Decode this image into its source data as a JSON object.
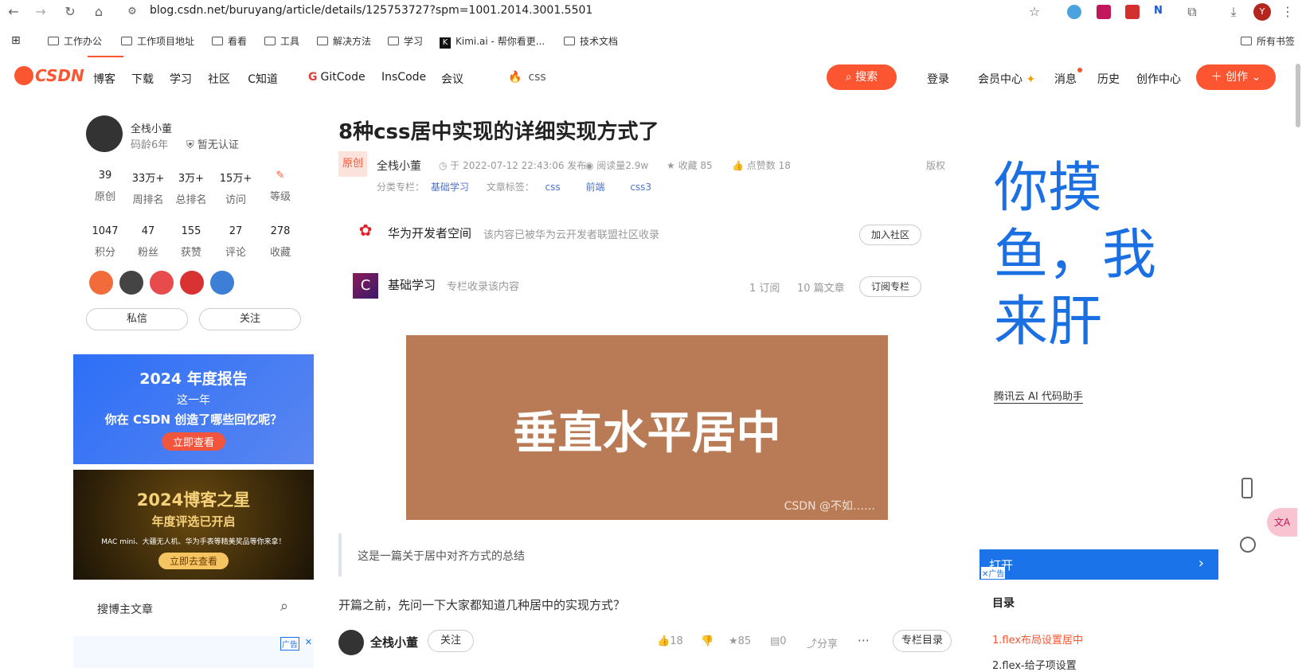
{
  "browser": {
    "url": "blog.csdn.net/buruyang/article/details/125753727?spm=1001.2014.3001.5501",
    "profile_initial": "Y",
    "bookmarks": [
      "工作办公",
      "工作项目地址",
      "看看",
      "工具",
      "解决方法",
      "学习",
      "Kimi.ai - 帮你看更...",
      "技术文档"
    ],
    "all_bookmarks": "所有书签"
  },
  "toolbar": {
    "logo": "CSDN",
    "nav": [
      "博客",
      "下载",
      "学习",
      "社区",
      "C知道",
      "GitCode",
      "InsCode",
      "会议"
    ],
    "search_placeholder": "css",
    "search_label": "搜索",
    "right": [
      "登录",
      "会员中心",
      "消息",
      "历史",
      "创作中心"
    ],
    "create_label": "创作"
  },
  "author": {
    "name": "全栈小董",
    "age": "码龄6年",
    "cert": "暂无认证",
    "stats_row1": [
      {
        "n": "39",
        "l": "原创"
      },
      {
        "n": "33万+",
        "l": "周排名"
      },
      {
        "n": "3万+",
        "l": "总排名"
      },
      {
        "n": "15万+",
        "l": "访问"
      },
      {
        "n": "",
        "l": "等级"
      }
    ],
    "stats_row2": [
      {
        "n": "1047",
        "l": "积分"
      },
      {
        "n": "47",
        "l": "粉丝"
      },
      {
        "n": "155",
        "l": "获赞"
      },
      {
        "n": "27",
        "l": "评论"
      },
      {
        "n": "278",
        "l": "收藏"
      }
    ],
    "message_label": "私信",
    "follow_label": "关注"
  },
  "ads": {
    "report_title": "2024 年度报告",
    "report_line1": "这一年",
    "report_line2": "你在 CSDN 创造了哪些回忆呢？",
    "report_btn": "立即查看",
    "star_title": "2024博客之星",
    "star_sub": "年度评选已开启",
    "star_desc": "MAC mini、大疆无人机、华为手表等精美奖品等你来拿！",
    "star_btn": "立即去查看",
    "ad_tag": "广告"
  },
  "search_blog": "搜博主文章",
  "article": {
    "title": "8种css居中实现的详细实现方式了",
    "original": "原创",
    "author": "全栈小董",
    "published": "于 2022-07-12 22:43:06 发布",
    "reads": "阅读量2.9w",
    "favorites": "收藏 85",
    "likes": "点赞数 18",
    "copyright": "版权",
    "category_label": "分类专栏：",
    "category": "基础学习",
    "tag_label": "文章标签：",
    "tags": [
      "css",
      "前端",
      "css3"
    ],
    "community_name": "华为开发者空间",
    "community_desc": "该内容已被华为云开发者联盟社区收录",
    "join_label": "加入社区",
    "column_name": "基础学习",
    "column_desc": "专栏收录该内容",
    "column_subs": "1 订阅",
    "column_count": "10 篇文章",
    "subscribe_label": "订阅专栏",
    "image_text": "垂直水平居中",
    "image_watermark": "CSDN @不如……",
    "quote": "这是一篇关于居中对齐方式的总结",
    "intro": "开篇之前，先问一下大家都知道几种居中的实现方式？",
    "bottom_author": "全栈小董",
    "bottom_follow": "关注",
    "bottom_likes": "18",
    "bottom_favs": "85",
    "bottom_comments": "0",
    "bottom_share": "分享",
    "bottom_toc": "专栏目录"
  },
  "right": {
    "slogan": [
      "你摸",
      "鱼，我",
      "来肝"
    ],
    "tencent": "腾讯云 AI 代码助手",
    "open_label": "打开",
    "ad_tag": "广告",
    "toc_title": "目录",
    "toc": [
      "1.flex布局设置居中",
      "2.flex-给子项设置"
    ]
  }
}
